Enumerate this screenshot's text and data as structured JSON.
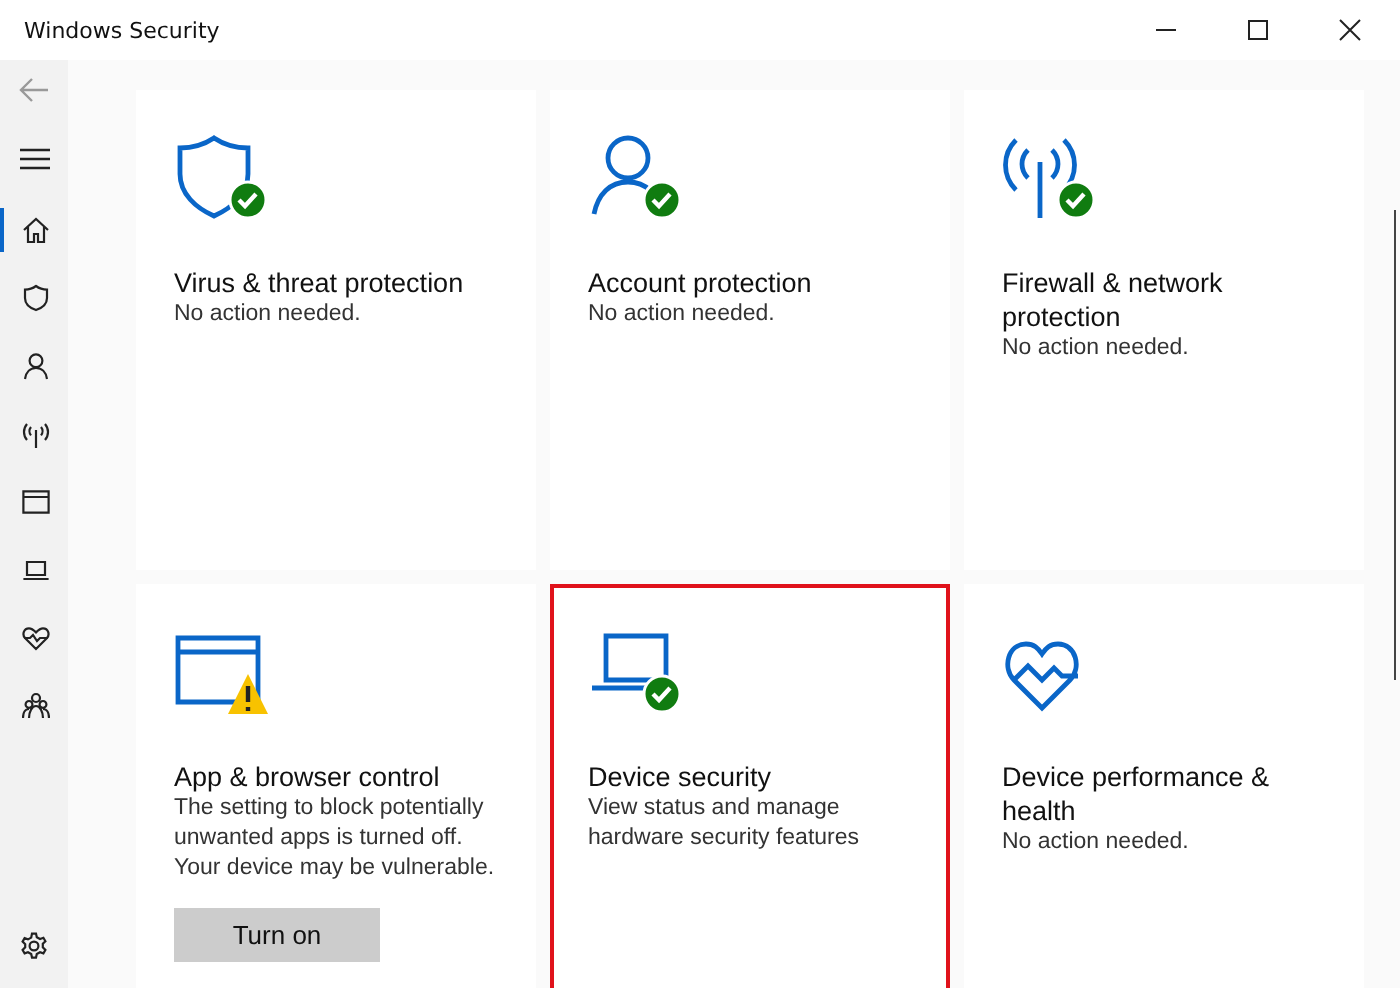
{
  "window": {
    "title": "Windows Security"
  },
  "sidebar": {
    "items": [
      {
        "kind": "home",
        "selected": true
      },
      {
        "kind": "shield",
        "selected": false
      },
      {
        "kind": "person",
        "selected": false
      },
      {
        "kind": "wifi",
        "selected": false
      },
      {
        "kind": "browser",
        "selected": false
      },
      {
        "kind": "laptop",
        "selected": false
      },
      {
        "kind": "heart",
        "selected": false
      },
      {
        "kind": "family",
        "selected": false
      }
    ]
  },
  "tiles": [
    {
      "kind": "shield",
      "badge": {
        "kind": "check"
      },
      "title": "Virus & threat protection",
      "description": "No action needed.",
      "highlighted": false
    },
    {
      "kind": "person",
      "badge": {
        "kind": "check"
      },
      "title": "Account protection",
      "description": "No action needed.",
      "highlighted": false
    },
    {
      "kind": "wifi",
      "badge": {
        "kind": "check"
      },
      "title": "Firewall & network protection",
      "description": "No action needed.",
      "highlighted": false
    },
    {
      "kind": "browser",
      "badge": {
        "kind": "warning"
      },
      "title": "App & browser control",
      "description": "The setting to block potentially unwanted apps is turned off. Your device may be vulnerable.",
      "button": "Turn on",
      "highlighted": false
    },
    {
      "kind": "laptop",
      "badge": {
        "kind": "check"
      },
      "title": "Device security",
      "description": "View status and manage hardware security features",
      "highlighted": true
    },
    {
      "kind": "heart",
      "title": "Device performance & health",
      "description": "No action needed.",
      "highlighted": false
    }
  ]
}
